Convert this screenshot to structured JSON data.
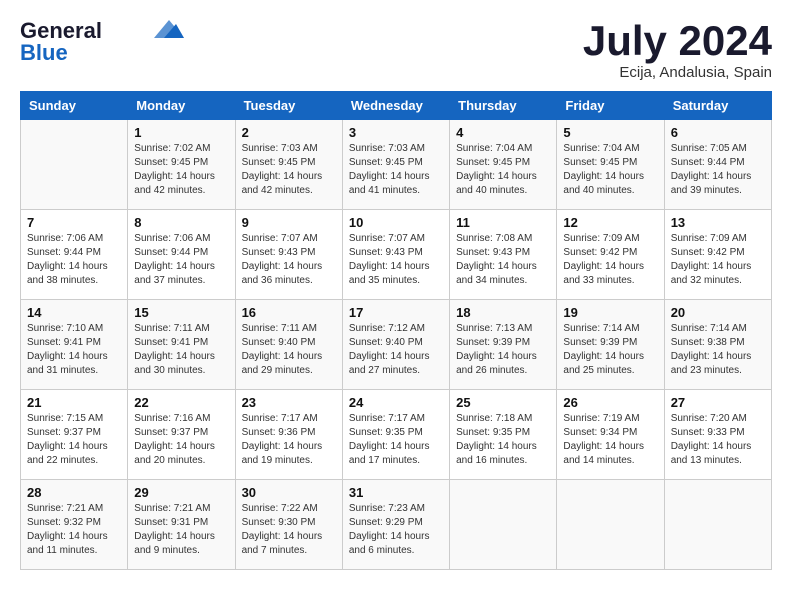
{
  "header": {
    "logo_line1": "General",
    "logo_line2": "Blue",
    "title": "July 2024",
    "subtitle": "Ecija, Andalusia, Spain"
  },
  "weekdays": [
    "Sunday",
    "Monday",
    "Tuesday",
    "Wednesday",
    "Thursday",
    "Friday",
    "Saturday"
  ],
  "weeks": [
    [
      {
        "day": "",
        "sunrise": "",
        "sunset": "",
        "daylight": ""
      },
      {
        "day": "1",
        "sunrise": "7:02 AM",
        "sunset": "9:45 PM",
        "daylight": "14 hours and 42 minutes."
      },
      {
        "day": "2",
        "sunrise": "7:03 AM",
        "sunset": "9:45 PM",
        "daylight": "14 hours and 42 minutes."
      },
      {
        "day": "3",
        "sunrise": "7:03 AM",
        "sunset": "9:45 PM",
        "daylight": "14 hours and 41 minutes."
      },
      {
        "day": "4",
        "sunrise": "7:04 AM",
        "sunset": "9:45 PM",
        "daylight": "14 hours and 40 minutes."
      },
      {
        "day": "5",
        "sunrise": "7:04 AM",
        "sunset": "9:45 PM",
        "daylight": "14 hours and 40 minutes."
      },
      {
        "day": "6",
        "sunrise": "7:05 AM",
        "sunset": "9:44 PM",
        "daylight": "14 hours and 39 minutes."
      }
    ],
    [
      {
        "day": "7",
        "sunrise": "7:06 AM",
        "sunset": "9:44 PM",
        "daylight": "14 hours and 38 minutes."
      },
      {
        "day": "8",
        "sunrise": "7:06 AM",
        "sunset": "9:44 PM",
        "daylight": "14 hours and 37 minutes."
      },
      {
        "day": "9",
        "sunrise": "7:07 AM",
        "sunset": "9:43 PM",
        "daylight": "14 hours and 36 minutes."
      },
      {
        "day": "10",
        "sunrise": "7:07 AM",
        "sunset": "9:43 PM",
        "daylight": "14 hours and 35 minutes."
      },
      {
        "day": "11",
        "sunrise": "7:08 AM",
        "sunset": "9:43 PM",
        "daylight": "14 hours and 34 minutes."
      },
      {
        "day": "12",
        "sunrise": "7:09 AM",
        "sunset": "9:42 PM",
        "daylight": "14 hours and 33 minutes."
      },
      {
        "day": "13",
        "sunrise": "7:09 AM",
        "sunset": "9:42 PM",
        "daylight": "14 hours and 32 minutes."
      }
    ],
    [
      {
        "day": "14",
        "sunrise": "7:10 AM",
        "sunset": "9:41 PM",
        "daylight": "14 hours and 31 minutes."
      },
      {
        "day": "15",
        "sunrise": "7:11 AM",
        "sunset": "9:41 PM",
        "daylight": "14 hours and 30 minutes."
      },
      {
        "day": "16",
        "sunrise": "7:11 AM",
        "sunset": "9:40 PM",
        "daylight": "14 hours and 29 minutes."
      },
      {
        "day": "17",
        "sunrise": "7:12 AM",
        "sunset": "9:40 PM",
        "daylight": "14 hours and 27 minutes."
      },
      {
        "day": "18",
        "sunrise": "7:13 AM",
        "sunset": "9:39 PM",
        "daylight": "14 hours and 26 minutes."
      },
      {
        "day": "19",
        "sunrise": "7:14 AM",
        "sunset": "9:39 PM",
        "daylight": "14 hours and 25 minutes."
      },
      {
        "day": "20",
        "sunrise": "7:14 AM",
        "sunset": "9:38 PM",
        "daylight": "14 hours and 23 minutes."
      }
    ],
    [
      {
        "day": "21",
        "sunrise": "7:15 AM",
        "sunset": "9:37 PM",
        "daylight": "14 hours and 22 minutes."
      },
      {
        "day": "22",
        "sunrise": "7:16 AM",
        "sunset": "9:37 PM",
        "daylight": "14 hours and 20 minutes."
      },
      {
        "day": "23",
        "sunrise": "7:17 AM",
        "sunset": "9:36 PM",
        "daylight": "14 hours and 19 minutes."
      },
      {
        "day": "24",
        "sunrise": "7:17 AM",
        "sunset": "9:35 PM",
        "daylight": "14 hours and 17 minutes."
      },
      {
        "day": "25",
        "sunrise": "7:18 AM",
        "sunset": "9:35 PM",
        "daylight": "14 hours and 16 minutes."
      },
      {
        "day": "26",
        "sunrise": "7:19 AM",
        "sunset": "9:34 PM",
        "daylight": "14 hours and 14 minutes."
      },
      {
        "day": "27",
        "sunrise": "7:20 AM",
        "sunset": "9:33 PM",
        "daylight": "14 hours and 13 minutes."
      }
    ],
    [
      {
        "day": "28",
        "sunrise": "7:21 AM",
        "sunset": "9:32 PM",
        "daylight": "14 hours and 11 minutes."
      },
      {
        "day": "29",
        "sunrise": "7:21 AM",
        "sunset": "9:31 PM",
        "daylight": "14 hours and 9 minutes."
      },
      {
        "day": "30",
        "sunrise": "7:22 AM",
        "sunset": "9:30 PM",
        "daylight": "14 hours and 7 minutes."
      },
      {
        "day": "31",
        "sunrise": "7:23 AM",
        "sunset": "9:29 PM",
        "daylight": "14 hours and 6 minutes."
      },
      {
        "day": "",
        "sunrise": "",
        "sunset": "",
        "daylight": ""
      },
      {
        "day": "",
        "sunrise": "",
        "sunset": "",
        "daylight": ""
      },
      {
        "day": "",
        "sunrise": "",
        "sunset": "",
        "daylight": ""
      }
    ]
  ]
}
